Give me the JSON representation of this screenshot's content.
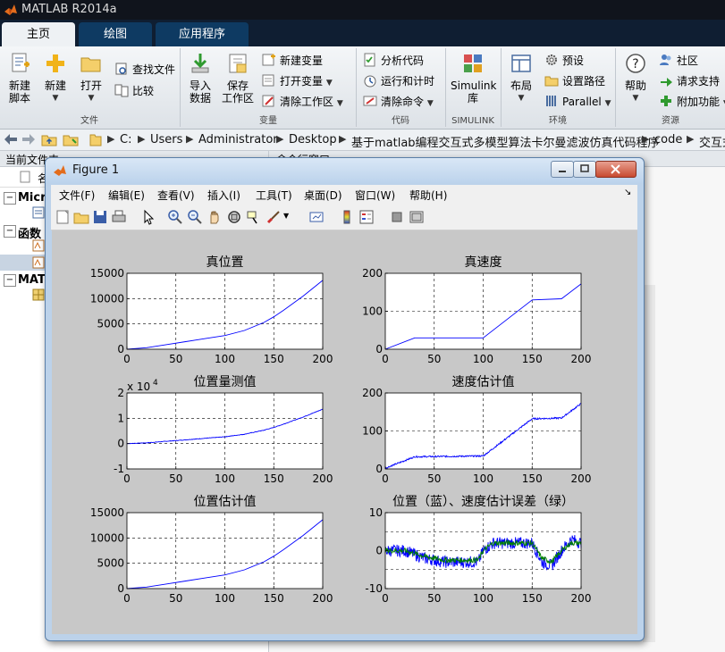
{
  "app": {
    "title": "MATLAB R2014a"
  },
  "tabs": [
    {
      "label": "主页",
      "active": true
    },
    {
      "label": "绘图",
      "active": false
    },
    {
      "label": "应用程序",
      "active": false
    }
  ],
  "ribbon": {
    "file": {
      "label": "文件",
      "new_script": "新建\n脚本",
      "new": "新建",
      "open": "打开",
      "find_files": "查找文件",
      "compare": "比较"
    },
    "variable": {
      "label": "变量",
      "import": "导入\n数据",
      "save_workspace": "保存\n工作区",
      "new_variable": "新建变量",
      "open_variable": "打开变量",
      "clear_workspace": "清除工作区"
    },
    "code": {
      "label": "代码",
      "analyze": "分析代码",
      "run_time": "运行和计时",
      "clear_commands": "清除命令"
    },
    "simulink": {
      "label": "SIMULINK",
      "button": "Simulink\n库"
    },
    "environment": {
      "label": "环境",
      "layout": "布局",
      "preferences": "预设",
      "set_path": "设置路径",
      "parallel": "Parallel"
    },
    "resources": {
      "label": "资源",
      "help": "帮助",
      "community": "社区",
      "request_support": "请求支持",
      "addons": "附加功能"
    }
  },
  "address": {
    "crumbs": [
      "C:",
      "Users",
      "Administrator",
      "Desktop",
      "基于matlab编程交互式多模型算法卡尔曼滤波仿真代码程序",
      "code",
      "交互式"
    ]
  },
  "left_panel": {
    "header": "当前文件夹",
    "name_col": "名",
    "sections": [
      "Micro",
      "函数",
      "MAT"
    ]
  },
  "right_panel": {
    "header": "命令行窗口"
  },
  "figure": {
    "title": "Figure 1",
    "menu": [
      "文件(F)",
      "编辑(E)",
      "查看(V)",
      "插入(I)",
      "工具(T)",
      "桌面(D)",
      "窗口(W)",
      "帮助(H)"
    ]
  },
  "colors": {
    "blue_line": "#0000ff",
    "green_line": "#008000"
  },
  "chart_data": [
    {
      "type": "line",
      "title": "真位置",
      "xlim": [
        0,
        200
      ],
      "ylim": [
        0,
        15000
      ],
      "xticks": [
        0,
        50,
        100,
        150,
        200
      ],
      "yticks": [
        0,
        5000,
        10000,
        15000
      ],
      "series": [
        {
          "color": "#0000ff",
          "x": [
            0,
            20,
            40,
            60,
            80,
            100,
            120,
            140,
            150,
            160,
            180,
            200
          ],
          "y": [
            0,
            300,
            900,
            1500,
            2100,
            2700,
            3700,
            5300,
            6400,
            7700,
            10500,
            13600
          ]
        }
      ]
    },
    {
      "type": "line",
      "title": "真速度",
      "xlim": [
        0,
        200
      ],
      "ylim": [
        0,
        200
      ],
      "xticks": [
        0,
        50,
        100,
        150,
        200
      ],
      "yticks": [
        0,
        100,
        200
      ],
      "series": [
        {
          "color": "#0000ff",
          "x": [
            0,
            30,
            100,
            150,
            180,
            200
          ],
          "y": [
            0,
            30,
            30,
            130,
            133,
            172
          ]
        }
      ]
    },
    {
      "type": "line",
      "title": "位置量测值",
      "exponent_label": "x 10",
      "exponent_power": "4",
      "xlim": [
        0,
        200
      ],
      "ylim": [
        -1,
        2
      ],
      "xticks": [
        0,
        50,
        100,
        150,
        200
      ],
      "yticks": [
        -1,
        0,
        1,
        2
      ],
      "series": [
        {
          "color": "#0000ff",
          "noise": 0.01,
          "x": [
            0,
            20,
            40,
            60,
            80,
            100,
            120,
            140,
            150,
            160,
            180,
            200
          ],
          "y": [
            0,
            0.03,
            0.09,
            0.15,
            0.21,
            0.27,
            0.37,
            0.53,
            0.64,
            0.77,
            1.05,
            1.36
          ]
        }
      ]
    },
    {
      "type": "line",
      "title": "速度估计值",
      "xlim": [
        0,
        200
      ],
      "ylim": [
        0,
        200
      ],
      "xticks": [
        0,
        50,
        100,
        150,
        200
      ],
      "yticks": [
        0,
        100,
        200
      ],
      "series": [
        {
          "color": "#0000ff",
          "noise": 2,
          "x": [
            0,
            30,
            100,
            150,
            180,
            200
          ],
          "y": [
            2,
            32,
            34,
            132,
            134,
            172
          ]
        }
      ]
    },
    {
      "type": "line",
      "title": "位置估计值",
      "xlim": [
        0,
        200
      ],
      "ylim": [
        0,
        15000
      ],
      "xticks": [
        0,
        50,
        100,
        150,
        200
      ],
      "yticks": [
        0,
        5000,
        10000,
        15000
      ],
      "series": [
        {
          "color": "#0000ff",
          "x": [
            0,
            20,
            40,
            60,
            80,
            100,
            120,
            140,
            150,
            160,
            180,
            200
          ],
          "y": [
            0,
            300,
            900,
            1500,
            2100,
            2700,
            3700,
            5300,
            6400,
            7700,
            10500,
            13600
          ]
        }
      ]
    },
    {
      "type": "line",
      "title": "位置（蓝）、速度估计误差（绿）",
      "xlim": [
        0,
        200
      ],
      "ylim": [
        -10,
        10
      ],
      "xticks": [
        0,
        50,
        100,
        150,
        200
      ],
      "yticks": [
        -10,
        0,
        10
      ],
      "grid_y_extra": [
        5,
        -5
      ],
      "series": [
        {
          "color": "#0000ff",
          "noise": 1.6,
          "x": [
            0,
            20,
            40,
            60,
            80,
            95,
            100,
            110,
            130,
            150,
            160,
            170,
            180,
            190,
            200
          ],
          "y": [
            0,
            0,
            -2,
            -3,
            -3,
            -3,
            0,
            2,
            2,
            2,
            -3,
            -4,
            0,
            3,
            2
          ]
        },
        {
          "color": "#008000",
          "noise": 0.7,
          "x": [
            0,
            20,
            40,
            60,
            80,
            95,
            100,
            110,
            130,
            150,
            160,
            170,
            180,
            190,
            200
          ],
          "y": [
            0,
            0,
            -1.5,
            -2.5,
            -2.5,
            -2.5,
            0,
            2,
            2,
            2,
            -2,
            -3,
            0,
            2,
            2
          ]
        }
      ]
    }
  ]
}
